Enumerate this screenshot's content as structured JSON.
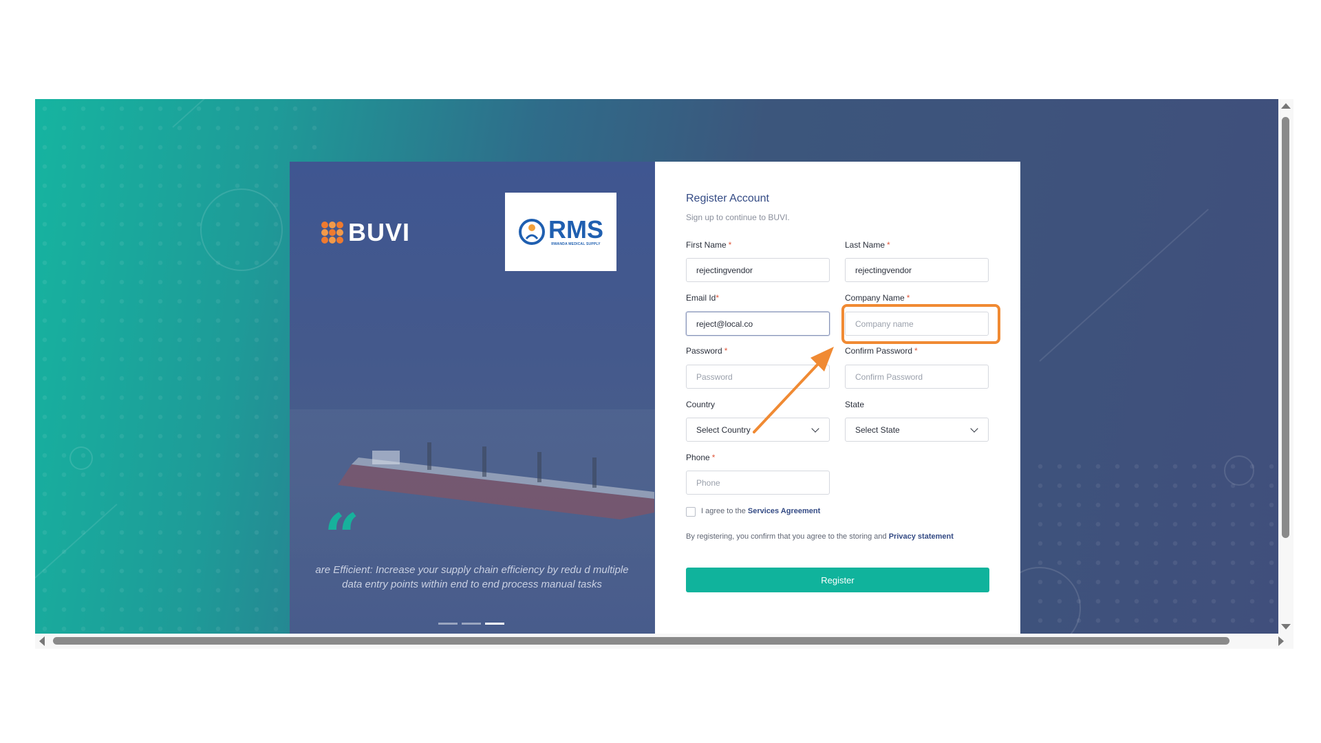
{
  "branding": {
    "app_name": "BUVI",
    "partner_logo_text": "RMS",
    "partner_logo_subtext": "RWANDA MEDICAL SUPPLY"
  },
  "carousel": {
    "quote_mark": "“",
    "slide_text": "are   Efficient: Increase your supply chain efficiency by redu d   multiple data entry points within end to end process manual tasks",
    "slide_count": 3,
    "active_slide": 3
  },
  "form": {
    "title": "Register Account",
    "subtitle": "Sign up to continue to BUVI.",
    "required_mark": "*",
    "first_name": {
      "label": "First Name",
      "value": "rejectingvendor",
      "required": true
    },
    "last_name": {
      "label": "Last Name",
      "value": "rejectingvendor",
      "required": true
    },
    "email": {
      "label": "Email Id",
      "value": "reject@local.co",
      "required": true
    },
    "company_name": {
      "label": "Company Name",
      "placeholder": "Company name",
      "required": true
    },
    "password": {
      "label": "Password",
      "placeholder": "Password",
      "required": true
    },
    "confirm_password": {
      "label": "Confirm Password",
      "placeholder": "Confirm Password",
      "required": true
    },
    "country": {
      "label": "Country",
      "selected": "Select Country"
    },
    "state": {
      "label": "State",
      "selected": "Select State"
    },
    "phone": {
      "label": "Phone",
      "placeholder": "Phone",
      "required": true
    },
    "agree_prefix": "I agree to the ",
    "agree_link": "Services Agreement",
    "consent_prefix": "By registering, you confirm that you agree to the storing and ",
    "consent_link": "Privacy statement",
    "register_label": "Register"
  },
  "colors": {
    "accent": "#10b39c",
    "title": "#334a84",
    "annotation": "#f08a33",
    "required": "#e0573b"
  },
  "icons": {
    "brand": "buvi-logo-icon",
    "partner": "rms-logo-icon",
    "select": "chevron-down-icon",
    "annotation": "arrow-icon"
  }
}
